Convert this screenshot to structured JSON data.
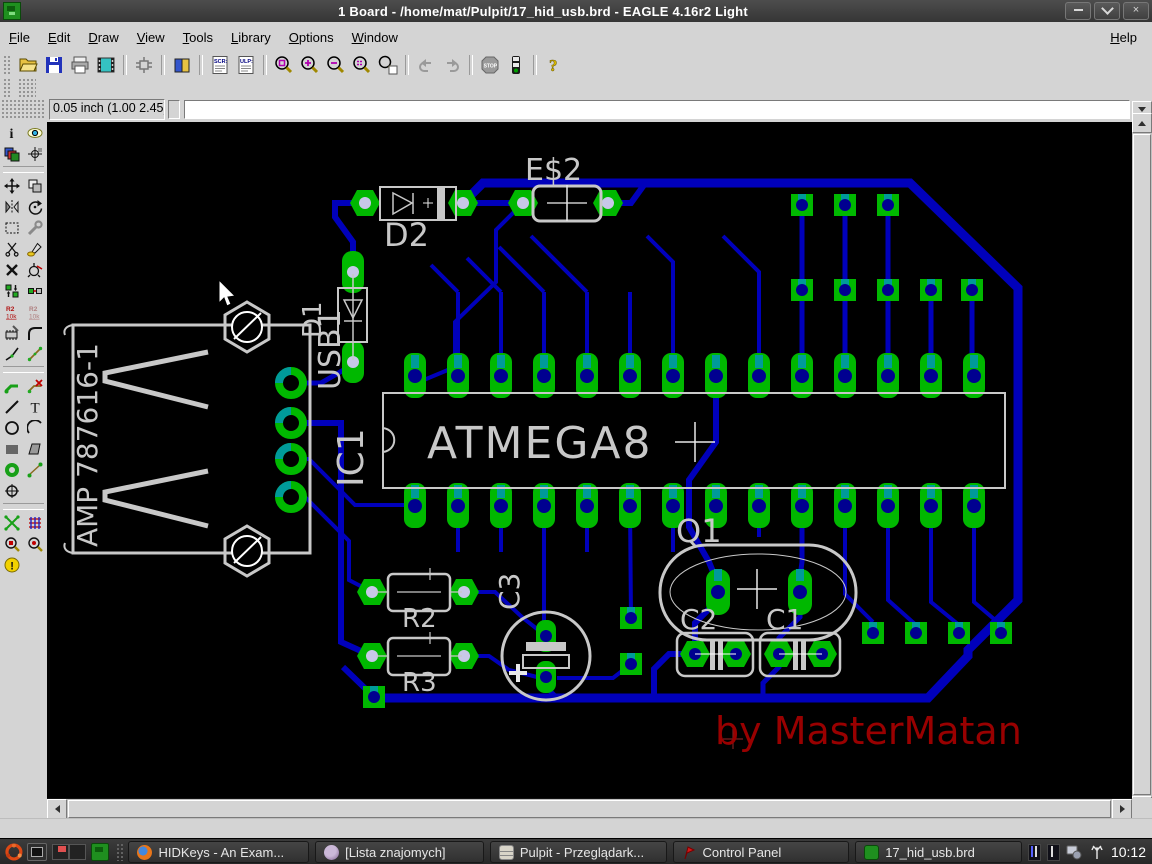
{
  "window": {
    "title": "1 Board - /home/mat/Pulpit/17_hid_usb.brd - EAGLE 4.16r2 Light",
    "app_icon": "eagle-board-icon",
    "controls": [
      "minimize",
      "maximize",
      "close"
    ]
  },
  "menu": {
    "items": [
      "File",
      "Edit",
      "Draw",
      "View",
      "Tools",
      "Library",
      "Options",
      "Window"
    ],
    "help": "Help"
  },
  "toolbar": {
    "icons": [
      "open",
      "save",
      "print",
      "cam-processor",
      "board-schematic",
      "use-library",
      "script",
      "run-ulp",
      "zoom-fit",
      "zoom-in",
      "zoom-out",
      "zoom-select",
      "zoom-redraw",
      "undo",
      "redo",
      "stop",
      "traffic-light",
      "help"
    ],
    "script_label": "SCR:",
    "ulp_label": "ULP:",
    "stop_label": "STOP"
  },
  "command_bar": {
    "coordinates": "0.05 inch (1.00 2.45)",
    "command_value": ""
  },
  "palette": {
    "tools": [
      "info",
      "show",
      "display",
      "mark",
      "move",
      "copy",
      "mirror",
      "rotate",
      "group",
      "change",
      "cut",
      "paste",
      "delete",
      "add",
      "pinswap",
      "replace",
      "name",
      "value",
      "smash",
      "miter",
      "split",
      "optimize",
      "route",
      "ripup",
      "wire",
      "text",
      "circle",
      "arc",
      "rect",
      "polygon",
      "via",
      "signal",
      "hole",
      "ratsnest",
      "auto",
      "drc",
      "erc",
      "errors"
    ],
    "icon_text": {
      "name_ref": "R2",
      "name_val": "10k"
    }
  },
  "canvas": {
    "background": "#000000",
    "colors": {
      "trace": "#0000bb",
      "pad": "#00b800",
      "silkscreen": "#c8c8c8",
      "signature": "#990000",
      "hole": "#000090"
    },
    "labels": {
      "d2": "D2",
      "e2": "E$2",
      "d1": "D1",
      "usb1": "USB1",
      "ic1": "IC1",
      "amp": "AMP 787616-1",
      "chip": "ATMEGA8",
      "q1": "Q1",
      "c1": "C1",
      "c2": "C2",
      "c3": "C3",
      "r2": "R2",
      "r3": "R3",
      "signature": "by MasterMatan"
    },
    "components": [
      {
        "ref": "USB1",
        "package": "AMP 787616-1",
        "type": "usb-connector"
      },
      {
        "ref": "IC1",
        "value": "ATMEGA8",
        "type": "dip-28"
      },
      {
        "ref": "D1",
        "type": "diode"
      },
      {
        "ref": "D2",
        "type": "diode"
      },
      {
        "ref": "E$2",
        "type": "axial-part"
      },
      {
        "ref": "R2",
        "type": "resistor"
      },
      {
        "ref": "R3",
        "type": "resistor"
      },
      {
        "ref": "C3",
        "type": "electrolytic-capacitor"
      },
      {
        "ref": "Q1",
        "type": "crystal"
      },
      {
        "ref": "C2",
        "type": "capacitor"
      },
      {
        "ref": "C1",
        "type": "capacitor"
      }
    ]
  },
  "status_bar": {
    "text": ""
  },
  "taskbar": {
    "launchers": [
      "ubuntu-menu",
      "screen-tool",
      "workspace-pager",
      "eagle-launcher"
    ],
    "items": [
      {
        "icon": "firefox",
        "label": "HIDKeys - An Exam..."
      },
      {
        "icon": "pidgin",
        "label": "[Lista znajomych]"
      },
      {
        "icon": "file-manager",
        "label": "Pulpit - Przeglądark..."
      },
      {
        "icon": "control-panel",
        "label": "Control Panel"
      },
      {
        "icon": "eagle",
        "label": "17_hid_usb.brd"
      }
    ],
    "tray_icons": [
      "keyboard-indicator-1",
      "keyboard-indicator-2",
      "display-settings",
      "network"
    ],
    "clock": "10:12"
  }
}
